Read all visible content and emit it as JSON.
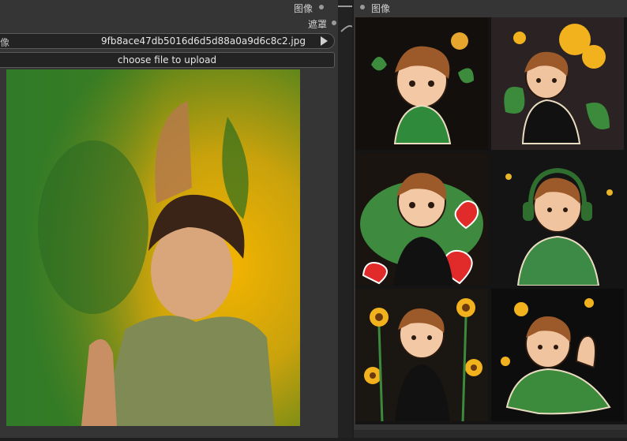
{
  "left_node": {
    "output_label": "图像",
    "output_label2": "遮罩",
    "widget_label": "像",
    "image_value": "9fb8ace47db5016d6d5d88a0a9d6c8c2.jpg",
    "upload_label": "choose file to upload"
  },
  "right_node": {
    "input_label": "图像"
  },
  "colors": {
    "node_bg": "#353535",
    "canvas_bg": "#1e1e1e",
    "widget_bg": "#232323",
    "link": "#9a9a9a"
  },
  "preview_grid": {
    "cells": [
      {
        "desc_icon": "boy-green-jacket-leaves-sticker"
      },
      {
        "desc_icon": "boy-balloons-dark-sticker"
      },
      {
        "desc_icon": "boy-hearts-sticker"
      },
      {
        "desc_icon": "boy-headphones-sticker"
      },
      {
        "desc_icon": "boy-sunflowers-sticker"
      },
      {
        "desc_icon": "boy-waving-sticker"
      }
    ]
  }
}
